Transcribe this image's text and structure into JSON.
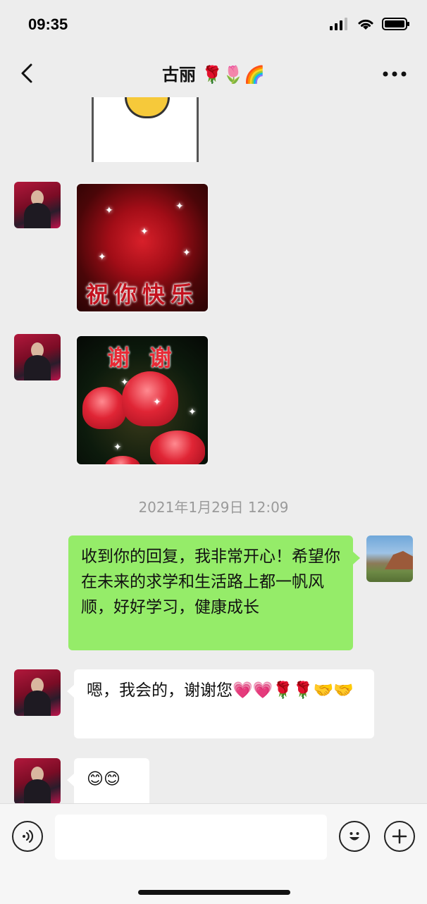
{
  "status_bar": {
    "time": "09:35"
  },
  "nav": {
    "title": "古丽 🌹🌷🌈"
  },
  "chat": {
    "sticker_flowers_caption": "祝你快乐",
    "sticker_tulips_caption": "谢 谢",
    "timestamp": "2021年1月29日 12:09",
    "messages": [
      {
        "side": "right",
        "text": "收到你的回复，我非常开心！希望你在未来的求学和生活路上都一帆风顺，好好学习，健康成长"
      },
      {
        "side": "left",
        "text": "嗯，我会的，谢谢您💗💗🌹🌹🤝🤝"
      },
      {
        "side": "left",
        "text": "😊😊"
      }
    ]
  },
  "input": {
    "placeholder": ""
  },
  "icons": {
    "back": "chevron-left-icon",
    "more": "more-dots-icon",
    "voice": "voice-icon",
    "emoji": "smiley-icon",
    "plus": "plus-icon"
  },
  "colors": {
    "bubble_sent": "#95ec69",
    "bubble_received": "#ffffff",
    "background": "#ededed"
  }
}
